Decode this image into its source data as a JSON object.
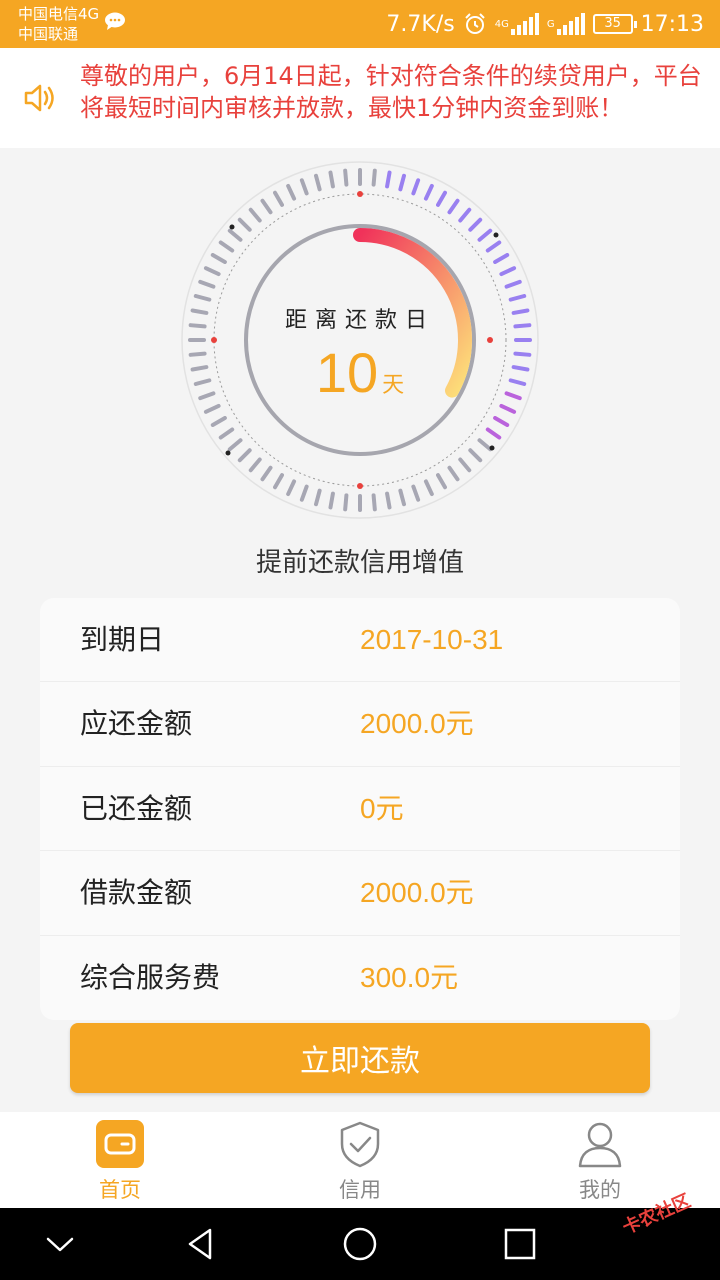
{
  "status": {
    "carrier1": "中国电信4G",
    "carrier2": "中国联通",
    "speed": "7.7K/s",
    "net1": "4G",
    "net2": "G",
    "battery": "35",
    "time": "17:13"
  },
  "notice": {
    "text": "尊敬的用户，6月14日起，针对符合条件的续贷用户，平台将最短时间内审核并放款，最快1分钟内资金到账！"
  },
  "dial": {
    "title": "距离还款日",
    "days": "10",
    "unit": "天",
    "progress": 0.33,
    "colors": {
      "start": "#f0325a",
      "end": "#fde27a",
      "tick": "#9a9aa8",
      "tick_accent": "#8a6cf0"
    }
  },
  "subtitle": "提前还款信用增值",
  "details": [
    {
      "label": "到期日",
      "value": "2017-10-31"
    },
    {
      "label": "应还金额",
      "value": "2000.0元"
    },
    {
      "label": "已还金额",
      "value": "0元"
    },
    {
      "label": "借款金额",
      "value": "2000.0元"
    },
    {
      "label": "综合服务费",
      "value": "300.0元"
    }
  ],
  "button": {
    "label": "立即还款"
  },
  "tabs": [
    {
      "label": "首页",
      "icon": "wallet-icon",
      "active": true
    },
    {
      "label": "信用",
      "icon": "shield-check-icon",
      "active": false
    },
    {
      "label": "我的",
      "icon": "user-icon",
      "active": false
    }
  ],
  "watermark": "卡农社区",
  "colors": {
    "accent": "#f5a623",
    "notice": "#e8413c"
  }
}
